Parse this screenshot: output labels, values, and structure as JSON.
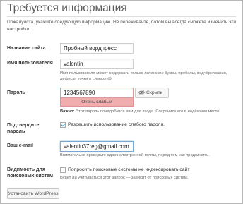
{
  "page": {
    "title": "Требуется информация",
    "intro": "Пожалуйста, укажите следующую информацию. Не переживайте, потом вы всегда сможете изменить эти настройки."
  },
  "fields": {
    "site_title": {
      "label": "Название сайта",
      "value": "Пробный вордпресс"
    },
    "username": {
      "label": "Имя пользователя",
      "value": "valentin",
      "help": "Имя пользователя может содержать только латинские буквы, пробелы, подчёркивания, дефисы, точки и символ @."
    },
    "password": {
      "label": "Пароль",
      "value": "1234567890",
      "hide_label": "Скрыть",
      "strength": "Очень слабый",
      "help_bold": "Важно:",
      "help": "Этот пароль понадобится вам для входа. Сохраните его в надёжном месте."
    },
    "confirm": {
      "label_line1": "Подтвердите",
      "label_line2": "пароль",
      "checkbox_label": "Разрешить использование слабого пароля.",
      "checked": true
    },
    "email": {
      "label": "Ваш e-mail",
      "value": "valentin37reg@gmail.com",
      "help": "Внимательно проверьте адрес электронной почты, перед тем как продолжить."
    },
    "visibility": {
      "label_line1": "Видимость для",
      "label_line2": "поисковых систем",
      "checkbox_label": "Попросить поисковые системы не индексировать сайт",
      "checked": false,
      "help": "Будет ли учитываться этот запрос — зависит от поисковых систем."
    }
  },
  "submit_label": "Установить WordPress",
  "colors": {
    "strength_bg": "#f1adad",
    "focus": "#7aa7cf",
    "check": "#1e8cbe"
  }
}
